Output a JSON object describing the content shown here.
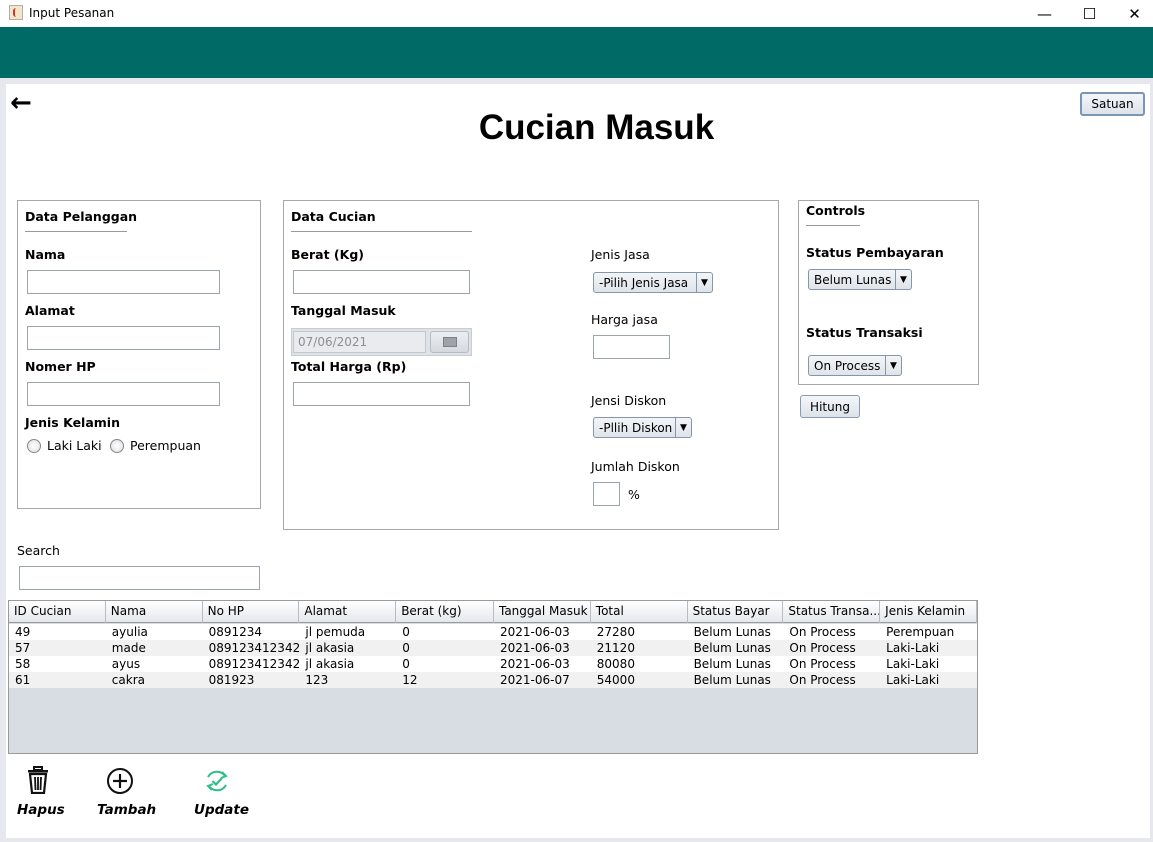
{
  "window": {
    "title": "Input Pesanan",
    "minimize": "—",
    "maximize": "☐",
    "close": "✕"
  },
  "header": {
    "back": "←",
    "title": "Cucian Masuk",
    "satuan_label": "Satuan"
  },
  "pelanggan": {
    "heading": "Data Pelanggan",
    "nama_label": "Nama",
    "nama_value": "",
    "alamat_label": "Alamat",
    "alamat_value": "",
    "hp_label": "Nomer HP",
    "hp_value": "",
    "gender_label": "Jenis Kelamin",
    "gender_options": [
      "Laki Laki",
      "Perempuan"
    ]
  },
  "cucian": {
    "heading": "Data Cucian",
    "berat_label": "Berat (Kg)",
    "berat_value": "",
    "tanggal_label": "Tanggal Masuk",
    "tanggal_value": "07/06/2021",
    "total_label": "Total Harga (Rp)",
    "total_value": "",
    "jenis_jasa_label": "Jenis Jasa",
    "jenis_jasa_value": "-Pilih Jenis Jasa",
    "harga_jasa_label": "Harga jasa",
    "harga_jasa_value": "",
    "diskon_label": "Jensi Diskon",
    "diskon_value": "-Pllih Diskon",
    "jumlah_diskon_label": "Jumlah Diskon",
    "jumlah_diskon_value": "",
    "percent": "%"
  },
  "controls": {
    "heading": "Controls",
    "pembayaran_label": "Status Pembayaran",
    "pembayaran_value": "Belum Lunas",
    "transaksi_label": "Status Transaksi",
    "transaksi_value": "On Process",
    "hitung_label": "Hitung"
  },
  "search": {
    "label": "Search",
    "value": ""
  },
  "table": {
    "columns": [
      "ID Cucian",
      "Nama",
      "No HP",
      "Alamat",
      "Berat (kg)",
      "Tanggal Masuk",
      "Total",
      "Status Bayar",
      "Status Transa...",
      "Jenis Kelamin"
    ],
    "rows": [
      [
        "49",
        "ayulia",
        "0891234",
        "jl pemuda",
        "0",
        "2021-06-03",
        "27280",
        "Belum Lunas",
        "On Process",
        "Perempuan"
      ],
      [
        "57",
        "made",
        "089123412342",
        "jl akasia",
        "0",
        "2021-06-03",
        "21120",
        "Belum Lunas",
        "On Process",
        "Laki-Laki"
      ],
      [
        "58",
        "ayus",
        "089123412342",
        "jl akasia",
        "0",
        "2021-06-03",
        "80080",
        "Belum Lunas",
        "On Process",
        "Laki-Laki"
      ],
      [
        "61",
        "cakra",
        "081923",
        "123",
        "12",
        "2021-06-07",
        "54000",
        "Belum Lunas",
        "On Process",
        "Laki-Laki"
      ]
    ]
  },
  "toolbar": {
    "hapus": "Hapus",
    "tambah": "Tambah",
    "update": "Update"
  },
  "colors": {
    "header": "#006b66",
    "update_icon": "#2fbf8a"
  }
}
